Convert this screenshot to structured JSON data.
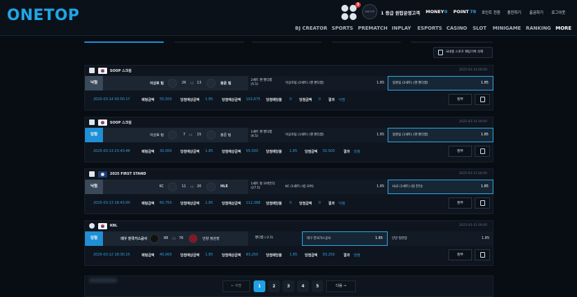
{
  "brand": {
    "logo": "ONETOP"
  },
  "header": {
    "notifications": "3",
    "avatar_text": "ONETOP",
    "level": "1 등급 원탑운영고객",
    "money_label": "MONEY",
    "money_value": "0",
    "point_label": "POINT",
    "point_value": "78",
    "links": [
      "포인트 전환",
      "충전하기",
      "출금하기",
      "로그아웃"
    ]
  },
  "nav": [
    "BJ CREATOR",
    "SPORTS",
    "PREMATCH",
    "INPLAY",
    "ESPORTS",
    "CASINO",
    "SLOT",
    "MINIGAME",
    "RANKING",
    "MORE"
  ],
  "delete_all_label": "국내형 스포츠 배팅기록 삭제",
  "row_labels": {
    "bet_amount": "배팅금액",
    "odds": "당첨예상금액",
    "expected": "당첨예상금액",
    "bet_odds": "당첨배당율",
    "win_amount": "당첨금액",
    "result": "결과",
    "detail": "정부"
  },
  "bets": [
    {
      "league": "SOOP 스크림",
      "time": "2025-03-14 00:00",
      "status": "낙첨",
      "home": "이상호 팀",
      "home_score": "26",
      "vs": "VS",
      "away_score": "13",
      "away": "봉준 팀",
      "market": "2세트 핸 핸디캡",
      "market2": "(5.5)",
      "option": "이상호팀 (2세트) (핸 핸디캡)",
      "option_odd": "1.85",
      "selected": "봉준팀 (2세트) (핸 핸디캡)",
      "selected_odd": "1.85",
      "bet_date": "2025-03-14 00:50:17",
      "bet_amount": "55,500",
      "odds": "1.85",
      "expected": "102,675",
      "bet_odds": "0",
      "win_amount": "0",
      "result": "낙첨"
    },
    {
      "league": "SOOP 스크림",
      "time": "2025-03-14 00:00",
      "status": "당첨",
      "home": "이상호 팀",
      "home_score": "7",
      "vs": "VS",
      "away_score": "15",
      "away": "봉준 팀",
      "market": "1세트 핸 핸디캡",
      "market2": "(6.5)",
      "option": "이상호팀 (1세트) (핸 핸디캡)",
      "option_odd": "1.85",
      "selected": "봉준팀 (1세트) (핸 핸디캡)",
      "selected_odd": "1.85",
      "bet_date": "2025-03-13 23:43:48",
      "bet_amount": "30,000",
      "odds": "1.85",
      "expected": "55,500",
      "bet_odds": "1.85",
      "win_amount": "55,500",
      "result": "당첨"
    },
    {
      "league": "2025 FIRST STAND",
      "time": "2025-03-13 00:00",
      "status": "낙첨",
      "home": "KC",
      "home_score": "11",
      "vs": "VS",
      "away_score": "20",
      "away": "HLE",
      "market": "1세트 킬 오버언더",
      "market2": "(27.5)",
      "option": "KC (1세트) (킬 오버)",
      "option_odd": "1.85",
      "selected": "HLE (1세트) (킬 언더)",
      "selected_odd": "1.85",
      "bet_date": "2025-03-13 18:43:00",
      "bet_amount": "60,750",
      "odds": "1.85",
      "expected": "112,388",
      "bet_odds": "0",
      "win_amount": "0",
      "result": "낙첨"
    },
    {
      "league": "KBL",
      "time": "2025-03-12 00:00",
      "status": "당첨",
      "home": "대구 한국가스공사",
      "home_score": "88",
      "vs": "VS",
      "away_score": "76",
      "away": "안양 정관장",
      "market": "핸디캡 (-2.5)",
      "market2": "",
      "option": "대구 한국가스공사",
      "option_odd": "1.85",
      "selected": "안양 정관장",
      "selected_odd": "1.85",
      "bet_date": "2025-03-12 18:30:15",
      "bet_amount": "45,000",
      "odds": "1.85",
      "expected": "83,250",
      "bet_odds": "1.85",
      "win_amount": "83,250",
      "result": "당첨"
    }
  ],
  "pagination": {
    "prev": "← 이전",
    "pages": [
      "1",
      "2",
      "3",
      "4",
      "5"
    ],
    "next": "다음 →",
    "current": "1"
  }
}
